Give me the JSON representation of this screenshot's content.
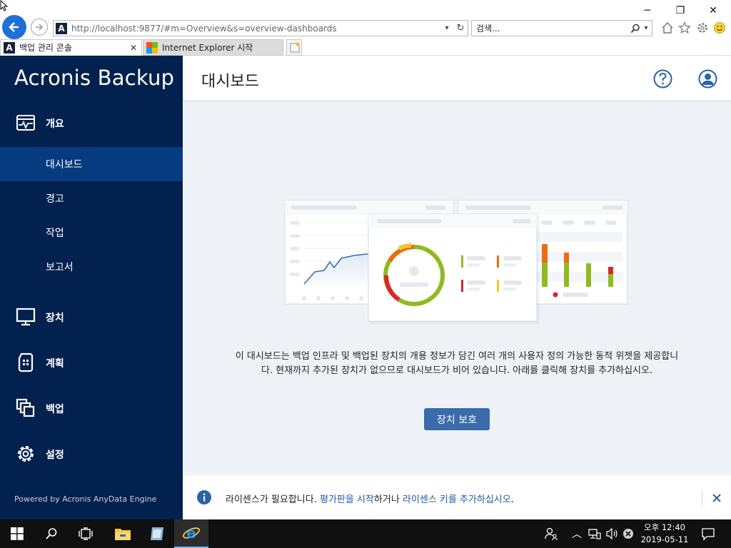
{
  "browser": {
    "address": "http://localhost:9877/#m=Overview&s=overview-dashboards",
    "address_host": "localhost",
    "search_placeholder": "검색...",
    "tabs": [
      {
        "label": "백업 관리 콘솔",
        "active": true
      },
      {
        "label": "Internet Explorer 시작",
        "active": false
      }
    ]
  },
  "app": {
    "logo": "Acronis Backup",
    "powered_by": "Powered by Acronis AnyData Engine",
    "page_title": "대시보드",
    "nav": {
      "overview": "개요",
      "sub": [
        "대시보드",
        "경고",
        "작업",
        "보고서"
      ],
      "devices": "장치",
      "plans": "계획",
      "backup": "백업",
      "settings": "설정"
    },
    "empty_message": "이 대시보드는 백업 인프라 및 백업된 장치의 개용 정보가 담긴 여러 개의 사용자 정의 가능한 동적 위젯을 제공합니다. 현재까지 추가된 장치가 없으므로 대시보드가 비어 있습니다. 아래를 클릭해 장치를 추가하십시오.",
    "protect_button": "장치 보호",
    "license": {
      "prefix": "라이센스가 필요합니다. ",
      "trial_link": "평가판을 시작",
      "middle": "하거나 ",
      "key_link": "라이센스 키를 추가하십시오",
      "suffix": "."
    }
  },
  "taskbar": {
    "time": "오후 12:40",
    "date": "2019-05-11"
  },
  "colors": {
    "sidebar": "#03214e",
    "sidebar_active": "#073b7f",
    "accent": "#3a6cab",
    "link": "#1f5aa6"
  }
}
